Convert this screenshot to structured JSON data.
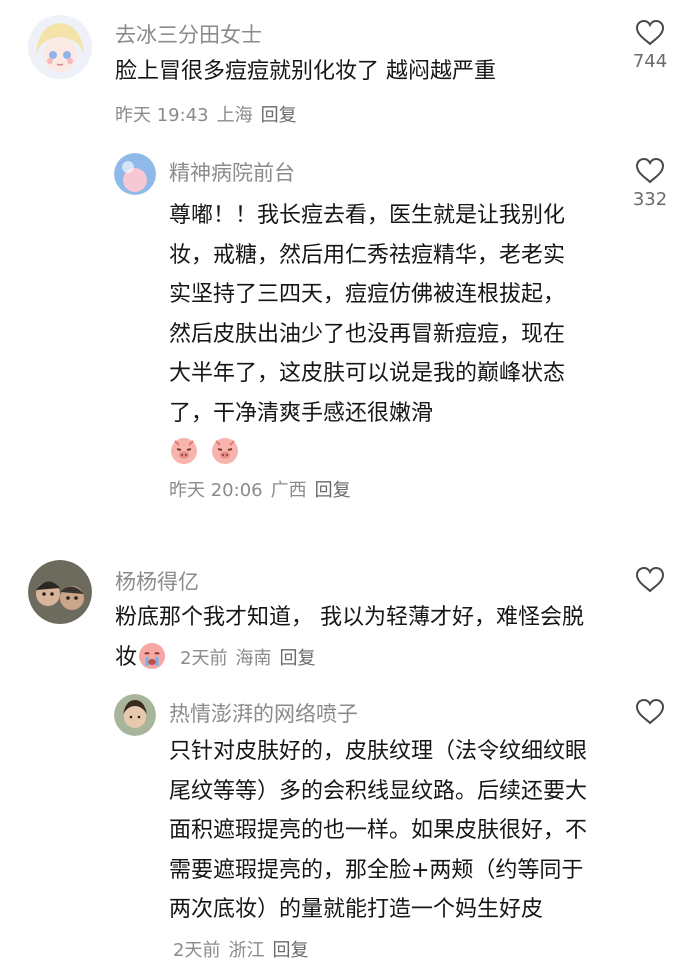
{
  "comments": [
    {
      "username": "去冰三分田女士",
      "text": "脸上冒很多痘痘就别化妆了 越闷越严重",
      "time": "昨天 19:43",
      "location": "上海",
      "reply": "回复",
      "likes": "744",
      "replies": [
        {
          "username": "精神病院前台",
          "text": "尊嘟！！我长痘去看，医生就是让我别化妆，戒糖，然后用仁秀祛痘精华，老老实实坚持了三四天，痘痘仿佛被连根拔起，然后皮肤出油少了也没再冒新痘痘，现在大半年了，这皮肤可以说是我的巅峰状态了，干净清爽手感还很嫩滑",
          "emojis": [
            "shy-pig-emoji",
            "shy-pig-emoji"
          ],
          "time": "昨天 20:06",
          "location": "广西",
          "reply": "回复",
          "likes": "332"
        }
      ]
    },
    {
      "username": "杨杨得亿",
      "text": "粉底那个我才知道， 我以为轻薄才好，难怪会脱妆",
      "emojis": [
        "crying-emoji"
      ],
      "time": "2天前",
      "location": "海南",
      "reply": "回复",
      "likes": "",
      "replies": [
        {
          "username": "热情澎湃的网络喷子",
          "text": "只针对皮肤好的，皮肤纹理（法令纹细纹眼尾纹等等）多的会积线显纹路。后续还要大面积遮瑕提亮的也一样。如果皮肤很好，不需要遮瑕提亮的，那全脸+两颊（约等同于两次底妆）的量就能打造一个妈生好皮",
          "time": "2天前",
          "location": "浙江",
          "reply": "回复",
          "likes": ""
        }
      ]
    }
  ]
}
